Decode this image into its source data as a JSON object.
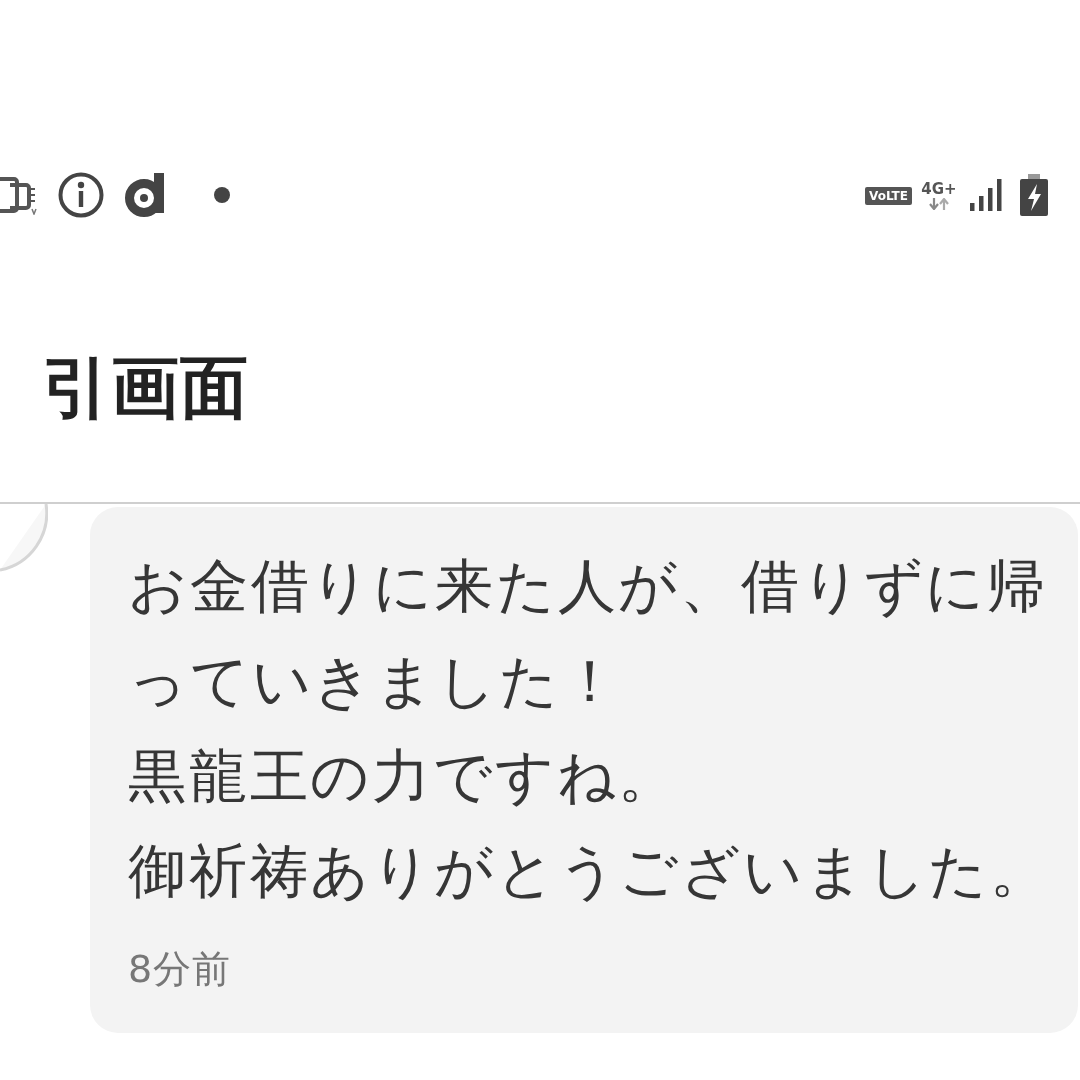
{
  "status_bar": {
    "volte_label": "VoLTE",
    "network_label": "4G+"
  },
  "header": {
    "title": "引画面"
  },
  "message": {
    "lines": [
      "お金借りに来た人が、借りずに帰っていきました！",
      "黒龍王の力ですね。",
      "御祈祷ありがとうございました。"
    ],
    "time": "8分前"
  }
}
